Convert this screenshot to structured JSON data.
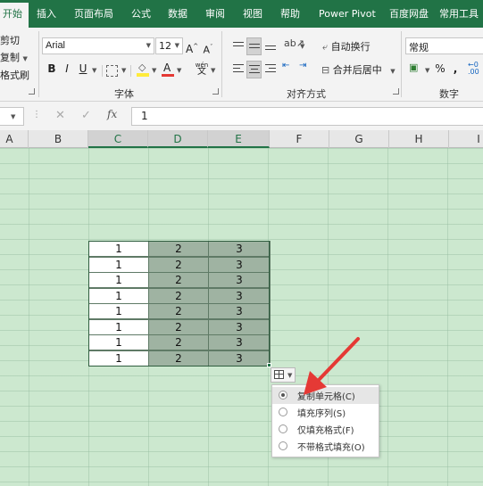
{
  "tabs": [
    "开始",
    "插入",
    "页面布局",
    "公式",
    "数据",
    "审阅",
    "视图",
    "帮助",
    "Power Pivot",
    "百度网盘",
    "常用工具"
  ],
  "ribbon": {
    "clipboard": {
      "cut": "剪切",
      "copy": "复制",
      "format_painter": "格式刷"
    },
    "font": {
      "name": "Arial",
      "size": "12",
      "grow": "A",
      "shrink": "A",
      "bold": "B",
      "italic": "I",
      "underline": "U",
      "label": "字体",
      "font_color_letter": "A",
      "phonetic": "wén"
    },
    "alignment": {
      "wrap": "自动换行",
      "merge": "合并后居中",
      "label": "对齐方式"
    },
    "number": {
      "format": "常规",
      "label": "数字",
      "percent": "%",
      "comma": ","
    }
  },
  "formula_bar": {
    "fx": "fx",
    "value": "1"
  },
  "columns": [
    "A",
    "B",
    "C",
    "D",
    "E",
    "F",
    "G",
    "H",
    "I"
  ],
  "cells": [
    [
      "1",
      "2",
      "3"
    ],
    [
      "1",
      "2",
      "3"
    ],
    [
      "1",
      "2",
      "3"
    ],
    [
      "1",
      "2",
      "3"
    ],
    [
      "1",
      "2",
      "3"
    ],
    [
      "1",
      "2",
      "3"
    ],
    [
      "1",
      "2",
      "3"
    ],
    [
      "1",
      "2",
      "3"
    ]
  ],
  "autofill_menu": [
    {
      "label": "复制单元格(C)",
      "selected": true
    },
    {
      "label": "填充序列(S)",
      "selected": false
    },
    {
      "label": "仅填充格式(F)",
      "selected": false
    },
    {
      "label": "不带格式填充(O)",
      "selected": false
    }
  ],
  "colors": {
    "excel_green": "#217346",
    "sheet_bg": "#cce8cf",
    "arrow": "#e53935",
    "selection_fill": "#9fb3a2"
  }
}
